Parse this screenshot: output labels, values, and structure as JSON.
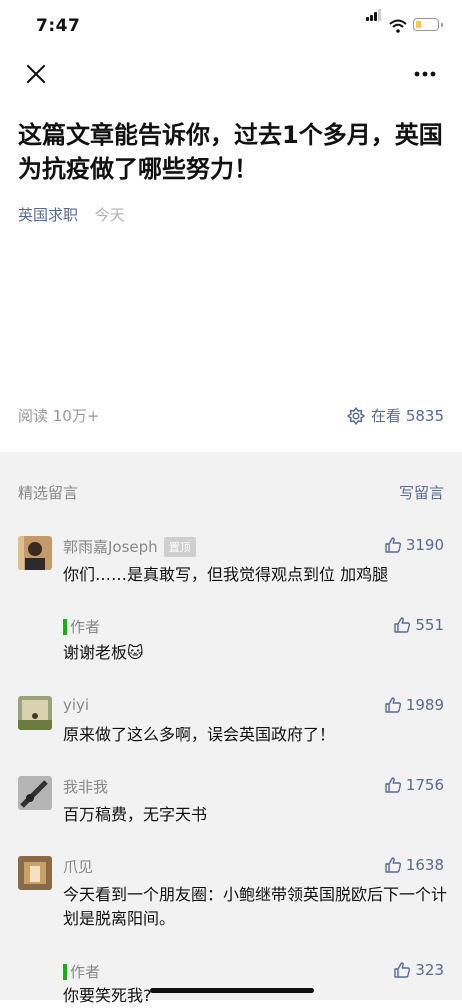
{
  "status": {
    "time": "7:47"
  },
  "article": {
    "title": "这篇文章能告诉你，过去1个多月，英国为抗疫做了哪些努力！",
    "author": "英国求职",
    "date": "今天",
    "reads": "阅读 10万+",
    "wow_label": "在看",
    "wow_count": "5835"
  },
  "comments_section": {
    "label": "精选留言",
    "write_label": "写留言"
  },
  "comments": [
    {
      "name": "郭雨嘉Joseph",
      "badge": "置顶",
      "likes": "3190",
      "text": "你们……是真敢写，但我觉得观点到位 加鸡腿",
      "reply": {
        "label": "作者",
        "likes": "551",
        "text": "谢谢老板🐱"
      }
    },
    {
      "name": "yiyi",
      "likes": "1989",
      "text": "原来做了这么多啊，误会英国政府了！"
    },
    {
      "name": "我非我",
      "likes": "1756",
      "text": "百万稿费，无字天书"
    },
    {
      "name": "爪见",
      "likes": "1638",
      "text": "今天看到一个朋友圈：小鲍继带领英国脱欧后下一个计划是脱离阳间。",
      "reply": {
        "label": "作者",
        "likes": "323",
        "text": "你要笑死我?"
      }
    }
  ],
  "colors": {
    "link": "#576b95",
    "reply_bar": "#1aad19",
    "comments_bg": "#f2f2f2"
  }
}
